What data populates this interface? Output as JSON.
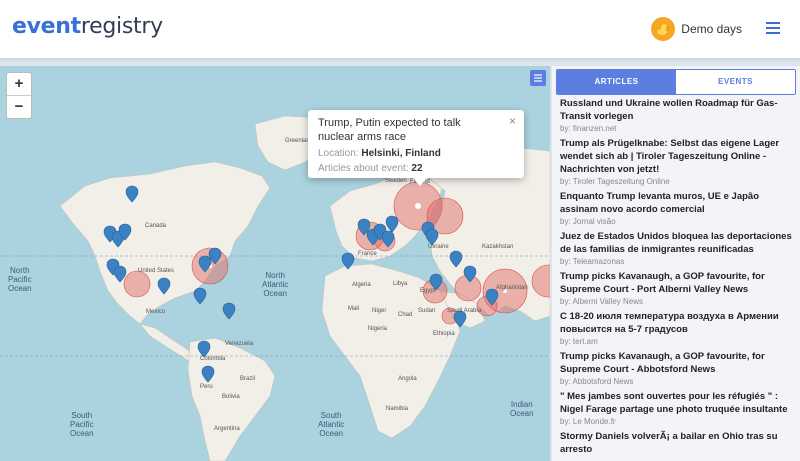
{
  "header": {
    "logo_part1": "event",
    "logo_part2": "registry",
    "user_name": "Demo days"
  },
  "map": {
    "zoom_in": "+",
    "zoom_out": "−",
    "oceans": [
      {
        "l1": "North",
        "l2": "Pacific",
        "l3": "Ocean"
      },
      {
        "l1": "North",
        "l2": "Atlantic",
        "l3": "Ocean"
      },
      {
        "l1": "South",
        "l2": "Pacific",
        "l3": "Ocean"
      },
      {
        "l1": "South",
        "l2": "Atlantic",
        "l3": "Ocean"
      },
      {
        "l1": "Indian",
        "l2": "Ocean"
      }
    ],
    "countries": [
      "Greenland",
      "Canada",
      "United States",
      "Mexico",
      "Venezuela",
      "Colombia",
      "Peru",
      "Brazil",
      "Bolivia",
      "Argentina",
      "France",
      "Algeria",
      "Libya",
      "Egypt",
      "Mali",
      "Niger",
      "Nigeria",
      "Chad",
      "Sudan",
      "Ethiopia",
      "Ukraine",
      "Kazakhstan",
      "Afghanistan",
      "Saudi Arabia",
      "Angola",
      "Namibia",
      "Sweden",
      "Finland"
    ]
  },
  "popup": {
    "title": "Trump, Putin expected to talk nuclear arms race",
    "location_label": "Location:",
    "location_value": "Helsinki, Finland",
    "count_label": "Articles about event:",
    "count_value": "22",
    "close": "×"
  },
  "panel": {
    "tabs": [
      "ARTICLES",
      "EVENTS"
    ],
    "articles": [
      {
        "title": "Russland und Ukraine wollen Roadmap für Gas-Transit vorlegen",
        "source": "by: finanzen.net"
      },
      {
        "title": "Trump als Prügelknabe: Selbst das eigene Lager wendet sich ab | Tiroler Tageszeitung Online - Nachrichten von jetzt!",
        "source": "by: Tiroler Tageszeitung Online"
      },
      {
        "title": "Enquanto Trump levanta muros, UE e Japão assinam novo acordo comercial",
        "source": "by: Jornal visão"
      },
      {
        "title": "Juez de Estados Unidos bloquea las deportaciones de las familias de inmigrantes reunificadas",
        "source": "by: Teleamazonas"
      },
      {
        "title": "Trump picks Kavanaugh, a GOP favourite, for Supreme Court - Port Alberni Valley News",
        "source": "by: Alberni Valley News"
      },
      {
        "title": "С 18-20 июля температура воздуха в Армении повысится на 5-7 градусов",
        "source": "by: tert.am"
      },
      {
        "title": "Trump picks Kavanaugh, a GOP favourite, for Supreme Court - Abbotsford News",
        "source": "by: Abbotsford News"
      },
      {
        "title": "\" Mes jambes sont ouvertes pour les réfugiés \" : Nigel Farage partage une photo truquée insultante",
        "source": "by: Le Monde.fr"
      },
      {
        "title": "Stormy Daniels volverÃ¡ a bailar en Ohio tras su arresto",
        "source": ""
      }
    ]
  },
  "colors": {
    "brand": "#3a6fd8",
    "ocean": "#aad3df",
    "land": "#f2efe9",
    "pin": "#3b82c4",
    "circle": "#e0706a",
    "tab_active": "#5c7ee0"
  }
}
